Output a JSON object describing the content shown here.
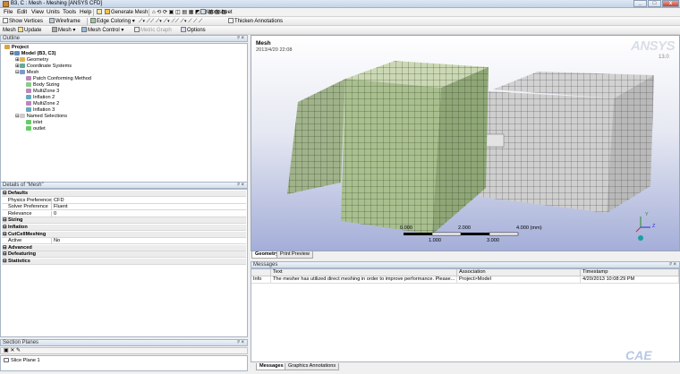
{
  "window": {
    "title": "B3, C : Mesh - Meshing [ANSYS CFD]"
  },
  "menu": [
    "File",
    "Edit",
    "View",
    "Units",
    "Tools",
    "Help"
  ],
  "toolbar1": {
    "generate_mesh": "Generate Mesh",
    "worksheet": "Worksheet"
  },
  "toolbar2": {
    "show_vertices": "Show Vertices",
    "wireframe": "Wireframe",
    "edge_coloring": "Edge Coloring",
    "thicken": "Thicken Annotations"
  },
  "toolbar3": {
    "mesh_label": "Mesh",
    "update": "Update",
    "mesh": "Mesh",
    "mesh_control": "Mesh Control",
    "metric_graph": "Metric Graph",
    "options": "Options"
  },
  "outline": {
    "header": "Outline",
    "nodes": [
      "Project",
      "Model (B3, C3)",
      "Geometry",
      "Coordinate Systems",
      "Mesh",
      "Patch Conforming Method",
      "Body Sizing",
      "MultiZone 3",
      "Inflation 2",
      "MultiZone 2",
      "Inflation 3",
      "Named Selections",
      "inlet",
      "outlet"
    ]
  },
  "details": {
    "header": "Details of \"Mesh\"",
    "rows": [
      {
        "k": "Defaults",
        "v": "",
        "grp": true
      },
      {
        "k": "Physics Preference",
        "v": "CFD",
        "grp": false
      },
      {
        "k": "Solver Preference",
        "v": "Fluent",
        "grp": false
      },
      {
        "k": "Relevance",
        "v": "0",
        "grp": false
      },
      {
        "k": "Sizing",
        "v": "",
        "grp": true
      },
      {
        "k": "Inflation",
        "v": "",
        "grp": true
      },
      {
        "k": "CutCellMeshing",
        "v": "",
        "grp": true
      },
      {
        "k": "Active",
        "v": "No",
        "grp": false
      },
      {
        "k": "Advanced",
        "v": "",
        "grp": true
      },
      {
        "k": "Defeaturing",
        "v": "",
        "grp": true
      },
      {
        "k": "Statistics",
        "v": "",
        "grp": true
      }
    ]
  },
  "viewport": {
    "title": "Mesh",
    "date": "2013/4/20 22:08",
    "brand": "ANSYS",
    "version": "13.0",
    "scale_top": [
      "0.000",
      "2.000",
      "4.000 (mm)"
    ],
    "scale_bottom": [
      "1.000",
      "3.000"
    ],
    "tabs": [
      "Geometry",
      "Print Preview"
    ]
  },
  "messages": {
    "header": "Messages",
    "columns": [
      "Text",
      "Association",
      "Timestamp"
    ],
    "row": {
      "type": "Info",
      "text": "The mesher has utilized direct meshing in order to improve performance. Please...",
      "assoc": "Project>Model",
      "time": "4/20/2013 10:08:29 PM"
    },
    "tabs": [
      "Messages",
      "Graphics Annotations"
    ]
  },
  "section": {
    "header": "Section Planes",
    "item": "Slice Plane 1"
  },
  "watermark": "CAE",
  "colors": {
    "box_front": "#a9bf8e",
    "box_top": "#cbd8b4",
    "box_right": "#8fa676",
    "mesh_line": "#2d3a24",
    "box2": "#c4c4c4"
  }
}
